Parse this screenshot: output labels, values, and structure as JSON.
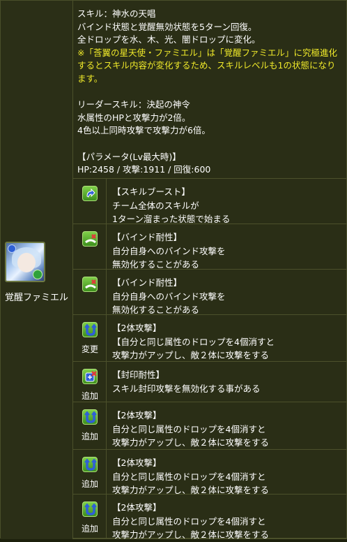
{
  "monster": {
    "name": "覚醒ファミエル"
  },
  "skill": {
    "line1": "スキル：神水の天唱",
    "line2": "バインド状態と覚醒無効状態を5ターン回復。",
    "line3": "全ドロップを水、木、光、闇ドロップに変化。",
    "warning": "※「莟翼の星天使・ファミエル」は「覚醒ファミエル」に究極進化するとスキル内容が変化するため、スキルレベルも1の状態になります。"
  },
  "leader": {
    "line1": "リーダースキル：決起の神令",
    "line2": "水属性のHPと攻撃力が2倍。",
    "line3": "4色以上同時攻撃で攻撃力が6倍。"
  },
  "params": {
    "title": "【パラメータ(Lv最大時)】",
    "stats": "HP:2458 / 攻撃:1911 / 回復:600"
  },
  "awakenings": [
    {
      "icon": "skill-boost-icon",
      "tag": "",
      "title": "【スキルブースト】",
      "lines": [
        "チーム全体のスキルが",
        "1ターン溜まった状態で始まる"
      ]
    },
    {
      "icon": "bind-resist-icon",
      "tag": "",
      "title": "【バインド耐性】",
      "lines": [
        "自分自身へのバインド攻撃を",
        "無効化することがある"
      ]
    },
    {
      "icon": "bind-resist-icon",
      "tag": "",
      "title": "【バインド耐性】",
      "lines": [
        "自分自身へのバインド攻撃を",
        "無効化することがある"
      ]
    },
    {
      "icon": "two-pronged-attack-icon",
      "tag": "変更",
      "title": "【2体攻撃】",
      "lines": [
        "【自分と同じ属性のドロップを4個消すと",
        "攻撃力がアップし、敵２体に攻撃をする"
      ]
    },
    {
      "icon": "seal-resist-icon",
      "tag": "追加",
      "title": "【封印耐性】",
      "lines": [
        "スキル封印攻撃を無効化する事がある"
      ]
    },
    {
      "icon": "two-pronged-attack-icon",
      "tag": "追加",
      "title": "【2体攻撃】",
      "lines": [
        "自分と同じ属性のドロップを4個消すと",
        "攻撃力がアップし、敵２体に攻撃をする"
      ]
    },
    {
      "icon": "two-pronged-attack-icon",
      "tag": "追加",
      "title": "【2体攻撃】",
      "lines": [
        "自分と同じ属性のドロップを4個消すと",
        "攻撃力がアップし、敵２体に攻撃をする"
      ]
    },
    {
      "icon": "two-pronged-attack-icon",
      "tag": "追加",
      "title": "【2体攻撃】",
      "lines": [
        "自分と同じ属性のドロップを4個消すと",
        "攻撃力がアップし、敵２体に攻撃をする"
      ]
    }
  ]
}
